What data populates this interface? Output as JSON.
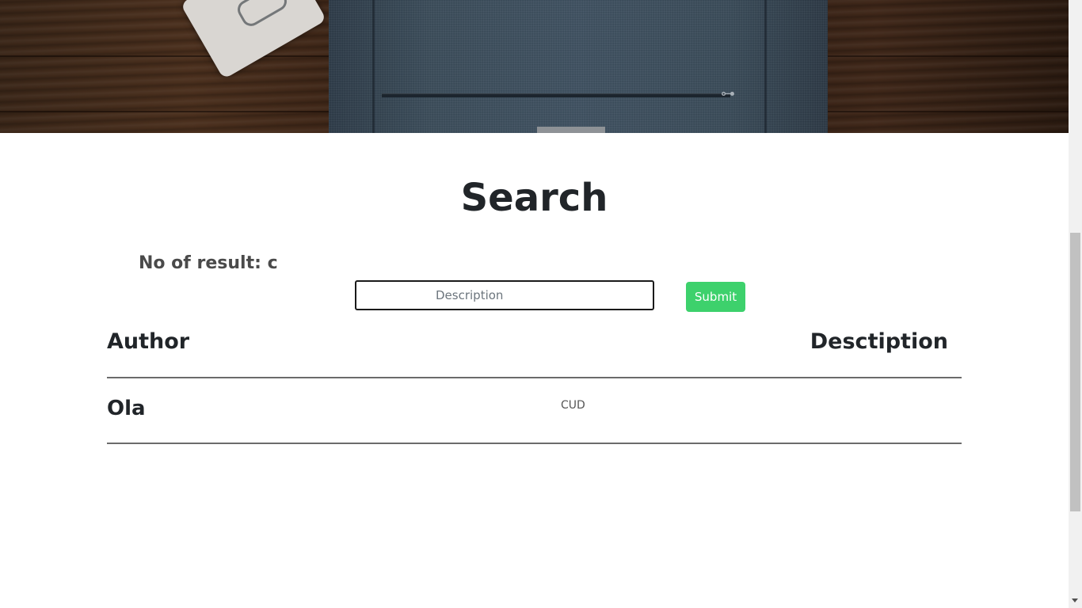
{
  "page": {
    "title": "Search",
    "result_count_label": "No of result: c"
  },
  "search": {
    "placeholder": "Description",
    "value": "",
    "submit_label": "Submit"
  },
  "table": {
    "columns": [
      "Author",
      "Desctiption"
    ],
    "rows": [
      {
        "author": "Ola",
        "description": "CUD"
      }
    ]
  },
  "colors": {
    "submit_button": "#3dd16c",
    "text": "#212529",
    "divider": "#6b6b6b"
  },
  "icons": {
    "scroll_down": "scroll-down-arrow-icon"
  }
}
